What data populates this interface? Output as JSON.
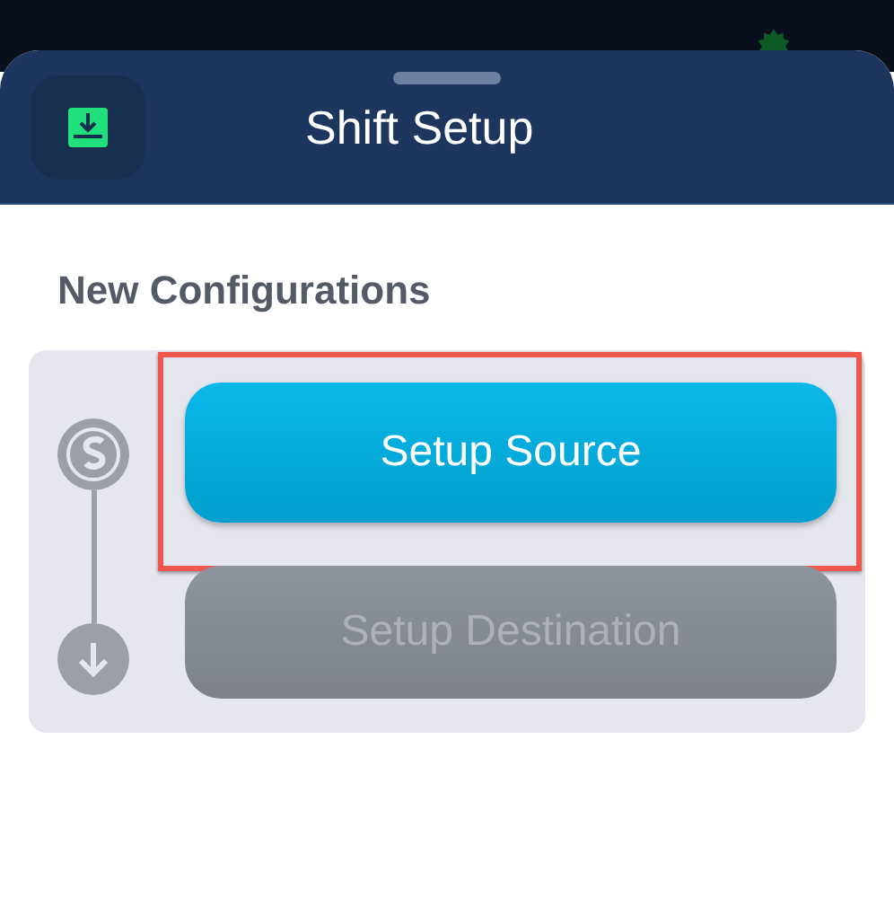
{
  "sheet": {
    "title": "Shift Setup"
  },
  "section": {
    "title": "New Configurations"
  },
  "steps": [
    {
      "kind": "source",
      "label": "Setup Source",
      "disabled": false,
      "highlighted": true
    },
    {
      "kind": "destination",
      "label": "Setup Destination",
      "disabled": true,
      "highlighted": false
    }
  ]
}
